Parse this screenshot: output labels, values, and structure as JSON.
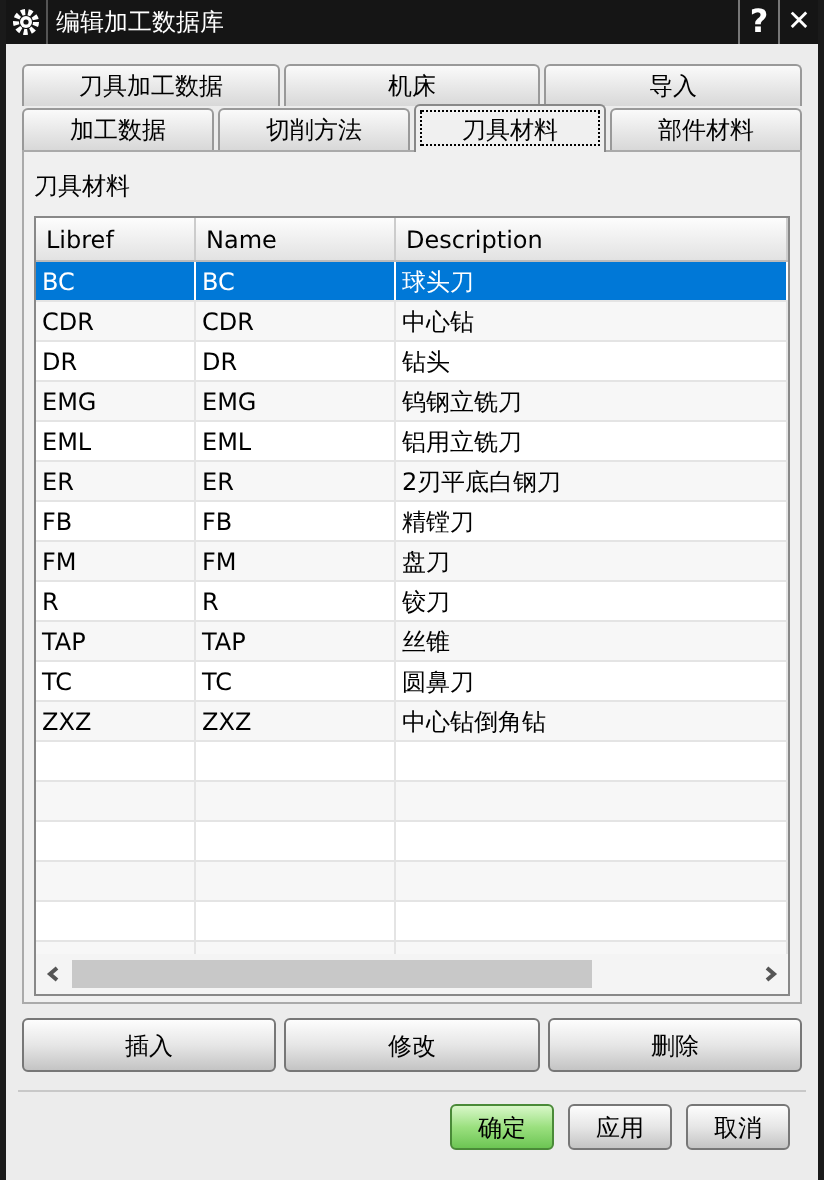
{
  "window": {
    "title": "编辑加工数据库",
    "help": "?",
    "close": "✕"
  },
  "tab_rows": [
    [
      {
        "label": "刀具加工数据",
        "selected": false
      },
      {
        "label": "机床",
        "selected": false
      },
      {
        "label": "导入",
        "selected": false
      }
    ],
    [
      {
        "label": "加工数据",
        "selected": false
      },
      {
        "label": "切削方法",
        "selected": false
      },
      {
        "label": "刀具材料",
        "selected": true
      },
      {
        "label": "部件材料",
        "selected": false
      }
    ]
  ],
  "section_label": "刀具材料",
  "table": {
    "columns": [
      "Libref",
      "Name",
      "Description"
    ],
    "rows": [
      {
        "cells": [
          "BC",
          "BC",
          "球头刀"
        ],
        "selected": true
      },
      {
        "cells": [
          "CDR",
          "CDR",
          "中心钻"
        ],
        "selected": false
      },
      {
        "cells": [
          "DR",
          "DR",
          "钻头"
        ],
        "selected": false
      },
      {
        "cells": [
          "EMG",
          "EMG",
          "钨钢立铣刀"
        ],
        "selected": false
      },
      {
        "cells": [
          "EML",
          "EML",
          "铝用立铣刀"
        ],
        "selected": false
      },
      {
        "cells": [
          "ER",
          "ER",
          "2刃平底白钢刀"
        ],
        "selected": false
      },
      {
        "cells": [
          "FB",
          "FB",
          "精镗刀"
        ],
        "selected": false
      },
      {
        "cells": [
          "FM",
          "FM",
          "盘刀"
        ],
        "selected": false
      },
      {
        "cells": [
          "R",
          "R",
          "铰刀"
        ],
        "selected": false
      },
      {
        "cells": [
          "TAP",
          "TAP",
          "丝锥"
        ],
        "selected": false
      },
      {
        "cells": [
          "TC",
          "TC",
          "圆鼻刀"
        ],
        "selected": false
      },
      {
        "cells": [
          "ZXZ",
          "ZXZ",
          "中心钻倒角钻"
        ],
        "selected": false
      }
    ]
  },
  "row_buttons": [
    "插入",
    "修改",
    "删除"
  ],
  "dialog_buttons": [
    {
      "label": "确定",
      "kind": "default"
    },
    {
      "label": "应用",
      "kind": "normal"
    },
    {
      "label": "取消",
      "kind": "normal"
    }
  ]
}
